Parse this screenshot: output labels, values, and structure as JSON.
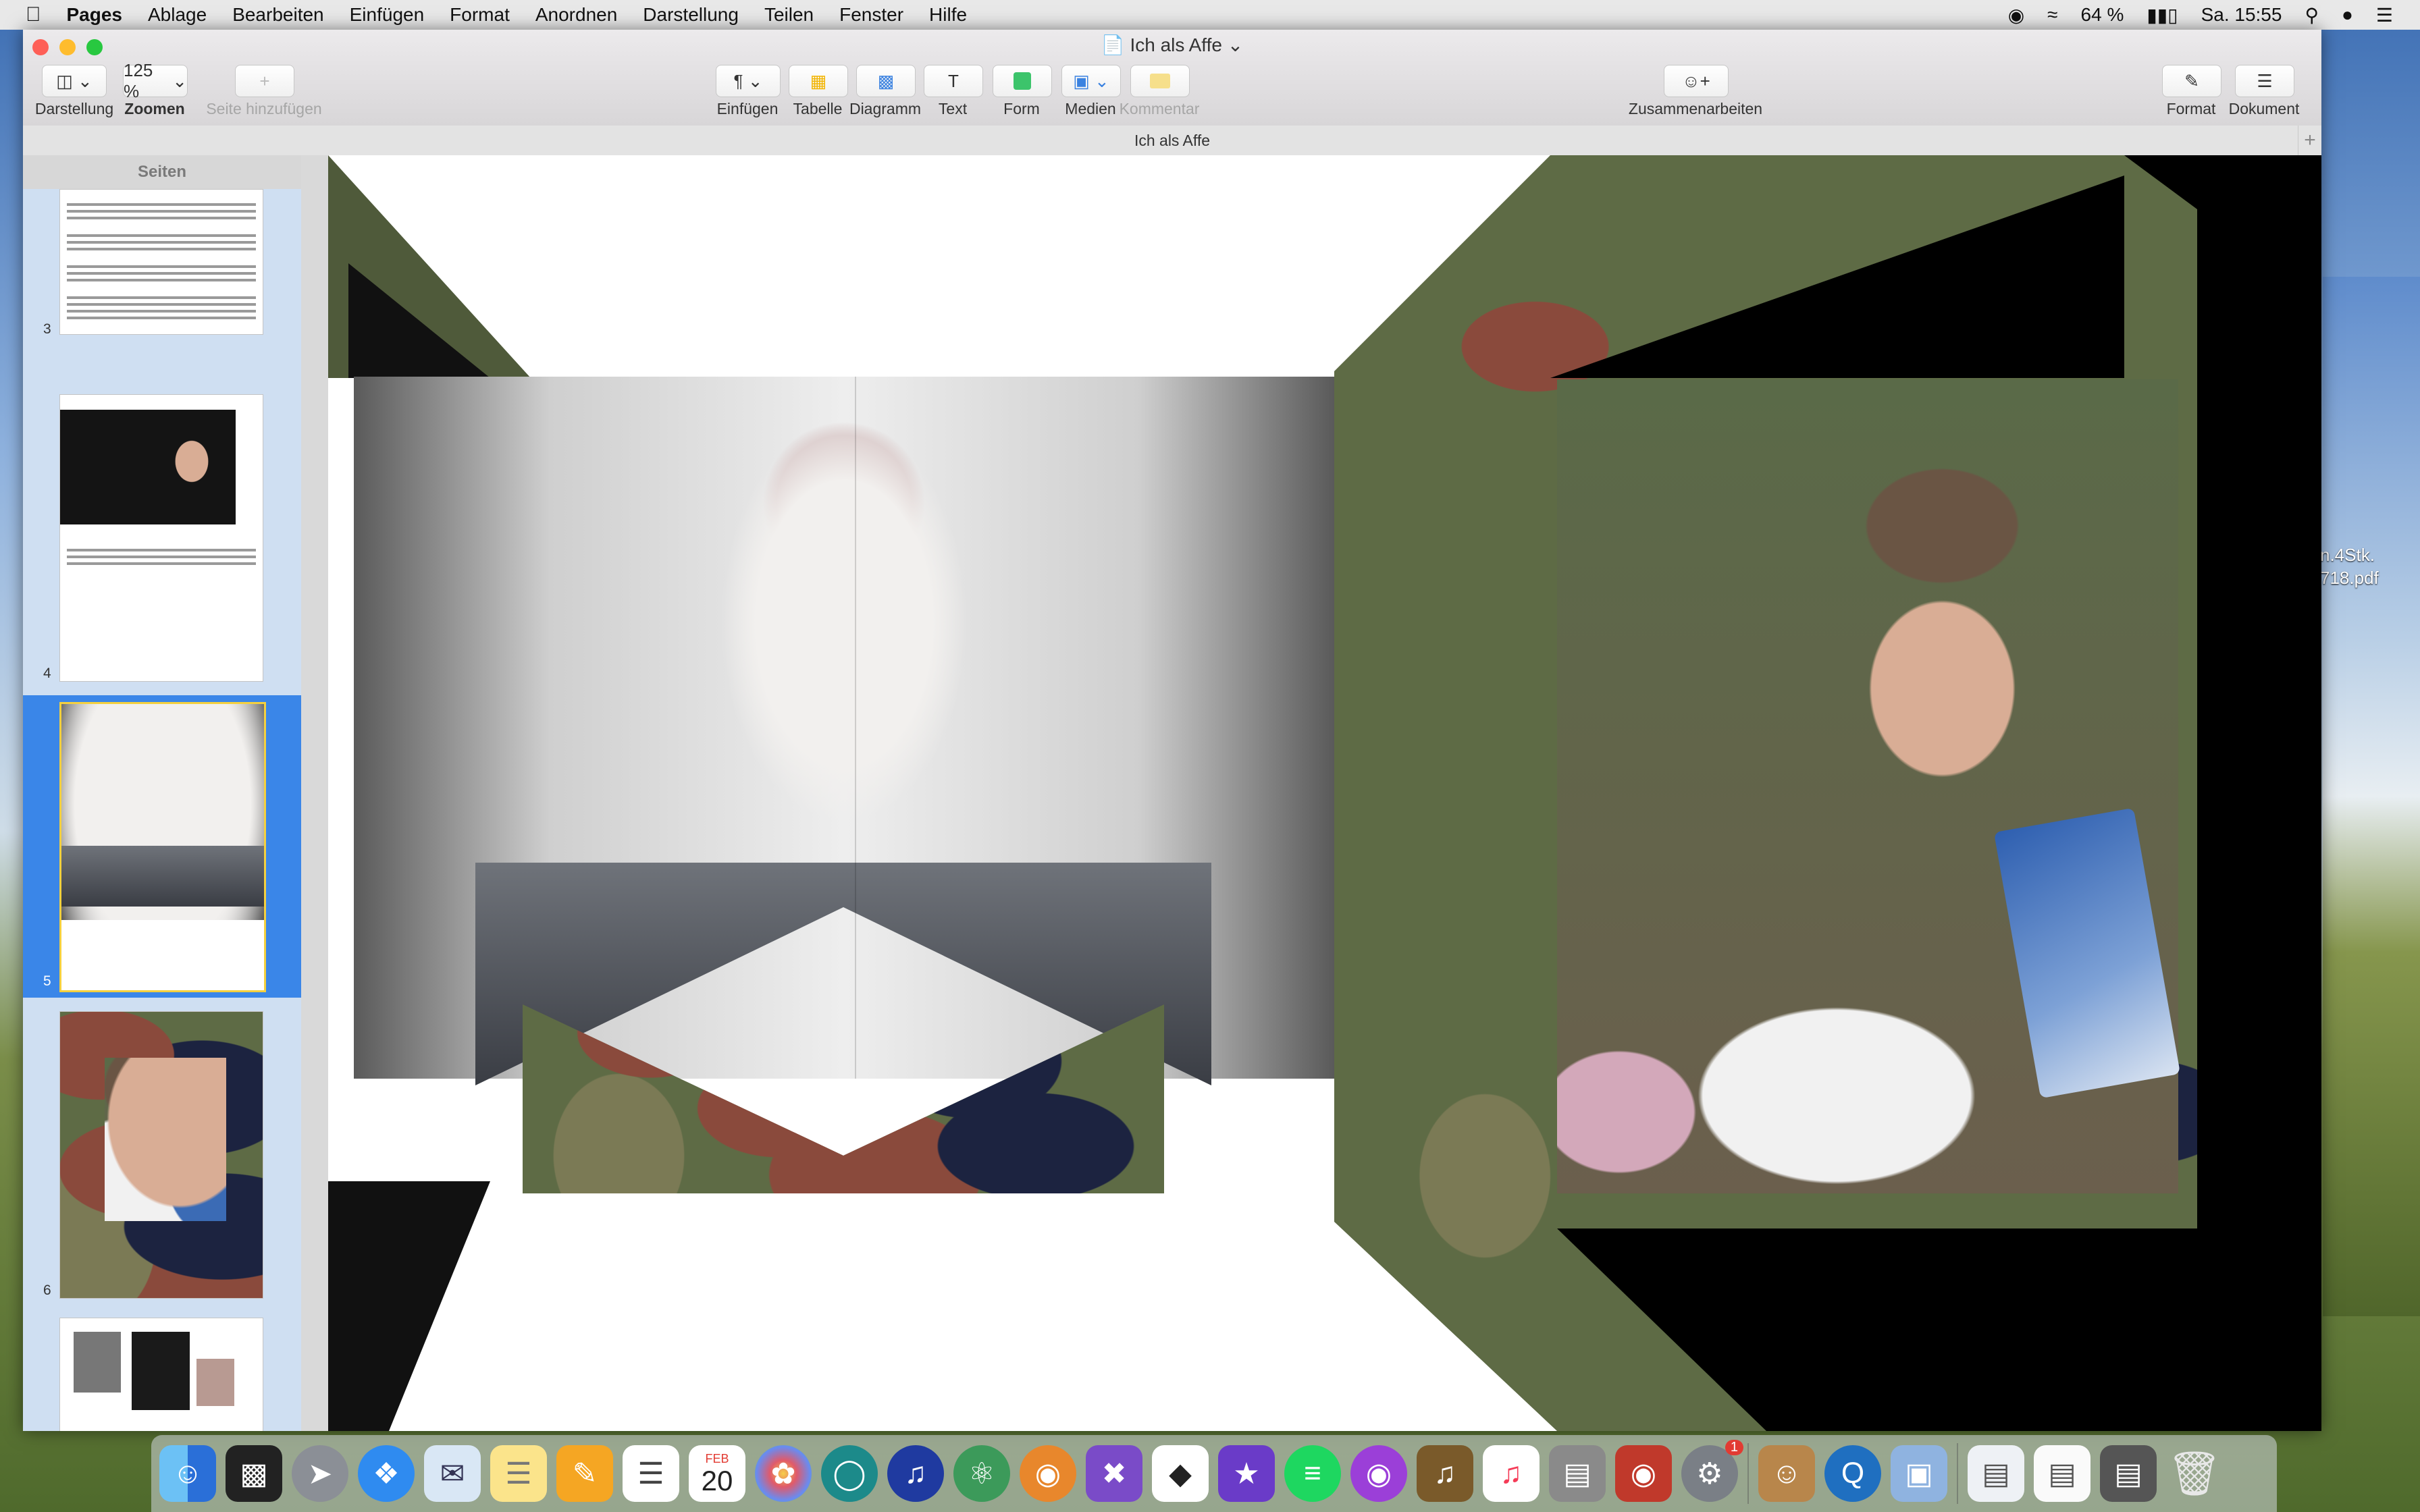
{
  "menubar": {
    "apple_icon": "apple-icon",
    "app_name": "Pages",
    "items": [
      "Ablage",
      "Bearbeiten",
      "Einfügen",
      "Format",
      "Anordnen",
      "Darstellung",
      "Teilen",
      "Fenster",
      "Hilfe"
    ],
    "battery": "64 %",
    "clock": "Sa. 15:55"
  },
  "window": {
    "title": "Ich als Affe",
    "doc_tab": "Ich als Affe"
  },
  "toolbar": {
    "view_label": "Darstellung",
    "zoom_value": "125 %",
    "zoom_label": "Zoomen",
    "add_page_label": "Seite hinzufügen",
    "insert_label": "Einfügen",
    "table_label": "Tabelle",
    "chart_label": "Diagramm",
    "text_label": "Text",
    "shape_label": "Form",
    "media_label": "Medien",
    "comment_label": "Kommentar",
    "collaborate_label": "Zusammenarbeiten",
    "format_label": "Format",
    "document_label": "Dokument"
  },
  "sidebar": {
    "header": "Seiten",
    "pages": [
      {
        "num": "3"
      },
      {
        "num": "4"
      },
      {
        "num": "5"
      },
      {
        "num": "6"
      }
    ]
  },
  "desktop": {
    "file_label_1": "n.4Stk.",
    "file_label_2": "718.pdf"
  },
  "dock": {
    "calendar_month": "FEB",
    "calendar_day": "20",
    "sysprefs_badge": "1"
  }
}
